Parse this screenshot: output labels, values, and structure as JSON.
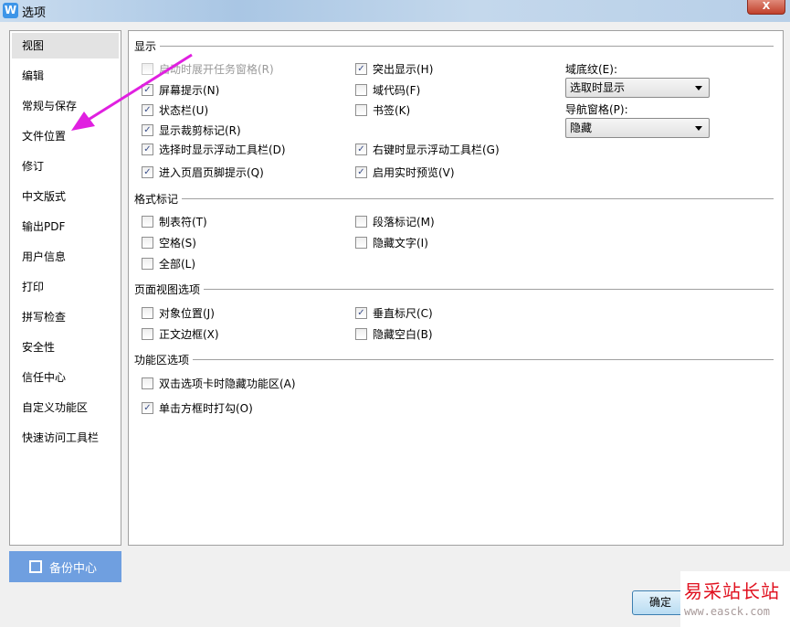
{
  "window": {
    "title": "选项",
    "close": "X",
    "app_icon": "W"
  },
  "nav": {
    "items": [
      "视图",
      "编辑",
      "常规与保存",
      "文件位置",
      "修订",
      "中文版式",
      "输出PDF",
      "用户信息",
      "打印",
      "拼写检查",
      "安全性",
      "信任中心",
      "自定义功能区",
      "快速访问工具栏"
    ],
    "selected": "视图"
  },
  "display": {
    "title": "显示",
    "col1": [
      {
        "label": "启动时展开任务窗格(R)",
        "checked": false,
        "disabled": true
      },
      {
        "label": "屏幕提示(N)",
        "checked": true
      },
      {
        "label": "状态栏(U)",
        "checked": true
      },
      {
        "label": "显示裁剪标记(R)",
        "checked": true
      },
      {
        "label": "选择时显示浮动工具栏(D)",
        "checked": true
      },
      {
        "label": "进入页眉页脚提示(Q)",
        "checked": true
      }
    ],
    "col2": [
      {
        "label": "突出显示(H)",
        "checked": true
      },
      {
        "label": "域代码(F)",
        "checked": false
      },
      {
        "label": "书签(K)",
        "checked": false
      },
      {
        "label": "右键时显示浮动工具栏(G)",
        "checked": true
      },
      {
        "label": "启用实时预览(V)",
        "checked": true
      }
    ],
    "field_shading_label": "域底纹(E):",
    "field_shading_value": "选取时显示",
    "nav_pane_label": "导航窗格(P):",
    "nav_pane_value": "隐藏"
  },
  "format": {
    "title": "格式标记",
    "items": [
      {
        "label": "制表符(T)",
        "checked": false
      },
      {
        "label": "段落标记(M)",
        "checked": false
      },
      {
        "label": "空格(S)",
        "checked": false
      },
      {
        "label": "隐藏文字(I)",
        "checked": false
      },
      {
        "label": "全部(L)",
        "checked": false
      }
    ]
  },
  "page_view": {
    "title": "页面视图选项",
    "items": [
      {
        "label": "对象位置(J)",
        "checked": false
      },
      {
        "label": "垂直标尺(C)",
        "checked": true
      },
      {
        "label": "正文边框(X)",
        "checked": false
      },
      {
        "label": "隐藏空白(B)",
        "checked": false
      }
    ]
  },
  "ribbon": {
    "title": "功能区选项",
    "items": [
      {
        "label": "双击选项卡时隐藏功能区(A)",
        "checked": false
      },
      {
        "label": "单击方框时打勾(O)",
        "checked": true
      }
    ]
  },
  "backup_label": "备份中心",
  "ok_label": "确定",
  "watermark": {
    "text": "易采站长站",
    "url": "www.easck.com"
  },
  "colors": {
    "arrow": "#e020e0",
    "backup": "#6f9fe0"
  }
}
